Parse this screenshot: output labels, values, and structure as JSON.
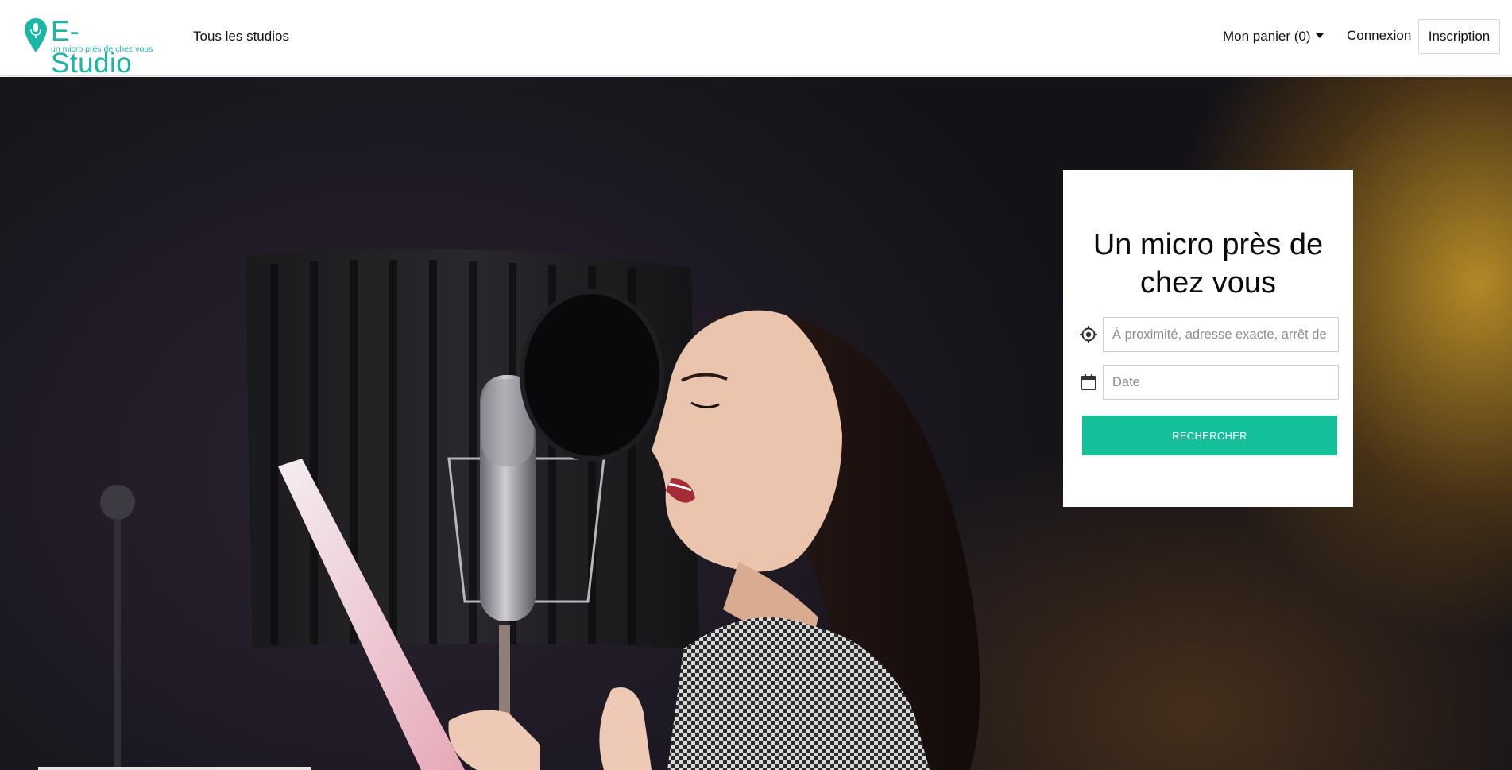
{
  "brand": {
    "name": "E-Studio",
    "tagline": "un micro près de chez vous",
    "color": "#19b8a6"
  },
  "nav": {
    "all_studios": "Tous les studios",
    "cart": "Mon panier (0)",
    "login": "Connexion",
    "signup": "Inscription"
  },
  "hero": {
    "image": "singer-in-recording-studio",
    "title": "Un micro près de chez vous"
  },
  "search": {
    "location_placeholder": "À proximité, adresse exacte, arrêt de métro",
    "location_icon": "crosshair-location-icon",
    "date_placeholder": "Date",
    "date_icon": "calendar-icon",
    "button_label": "RECHERCHER",
    "button_color": "#13c09a"
  }
}
